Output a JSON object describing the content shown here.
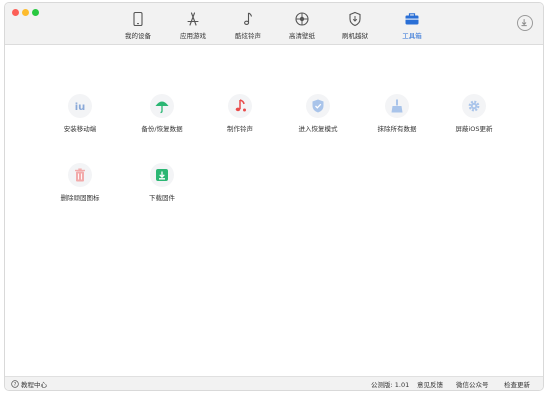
{
  "nav": [
    {
      "label": "我的设备",
      "icon": "phone-icon"
    },
    {
      "label": "应用游戏",
      "icon": "app-store-icon"
    },
    {
      "label": "酷炫铃声",
      "icon": "music-note-icon"
    },
    {
      "label": "高清壁纸",
      "icon": "wallpaper-icon"
    },
    {
      "label": "刷机越狱",
      "icon": "flash-jailbreak-icon"
    },
    {
      "label": "工具箱",
      "icon": "toolbox-icon",
      "active": true
    }
  ],
  "tools": [
    {
      "label": "安装移动端",
      "icon": "install-mobile-icon"
    },
    {
      "label": "备份/恢复数据",
      "icon": "umbrella-backup-icon"
    },
    {
      "label": "制作铃声",
      "icon": "ringtone-icon"
    },
    {
      "label": "进入恢复模式",
      "icon": "shield-icon"
    },
    {
      "label": "抹除所有数据",
      "icon": "broom-icon"
    },
    {
      "label": "屏蔽iOS更新",
      "icon": "gear-icon"
    },
    {
      "label": "删除顽固图标",
      "icon": "trash-icon"
    },
    {
      "label": "下载固件",
      "icon": "download-firmware-icon"
    }
  ],
  "footer": {
    "help": "教程中心",
    "version": "公测版: 1.01",
    "feedback": "意见反馈",
    "wechat": "微信公众号",
    "update": "检查更新"
  },
  "colors": {
    "accent": "#2a6fd6",
    "green": "#2bb673",
    "red": "#e94b4b"
  }
}
